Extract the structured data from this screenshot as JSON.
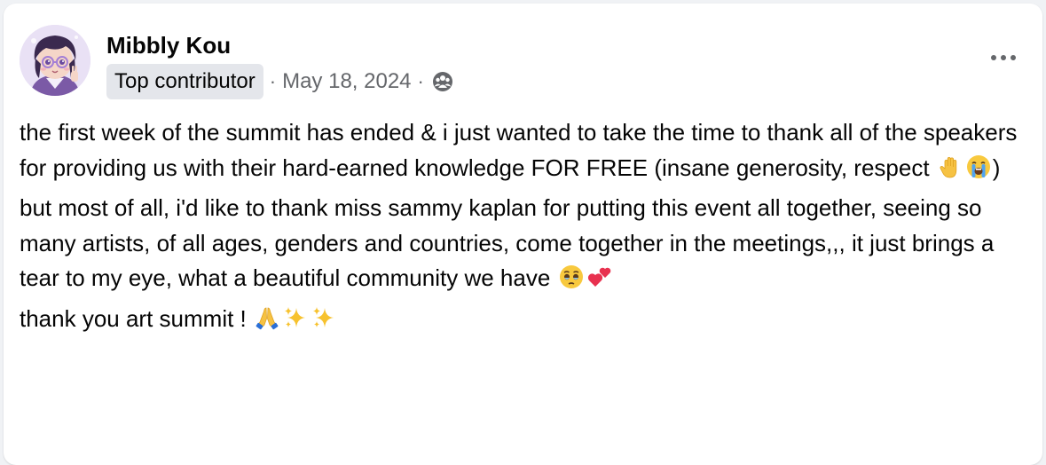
{
  "post": {
    "author": "Mibbly Kou",
    "badge": "Top contributor",
    "separator": "·",
    "date": "May 18, 2024",
    "audience_icon": "group-audience-icon",
    "more_icon": "more-options-icon",
    "paragraphs": [
      {
        "text": "the first week of the summit has ended & i just wanted to take the time to thank all of the speakers for providing us with their hard-earned knowledge FOR FREE (insane generosity, respect ",
        "after": ")"
      },
      {
        "text": "but most of all, i'd like to thank miss sammy kaplan for putting this event all together, seeing so many artists, of all ages, genders and countries, come together in the meetings,,, it just brings a tear to my eye, what a beautiful community we have ",
        "after": ""
      },
      {
        "text": "thank you art summit ! ",
        "after": ""
      }
    ]
  },
  "colors": {
    "page_bg": "#f0f2f5",
    "card_bg": "#ffffff",
    "badge_bg": "#e4e6eb",
    "secondary_text": "#65676b",
    "primary_text": "#050505"
  }
}
